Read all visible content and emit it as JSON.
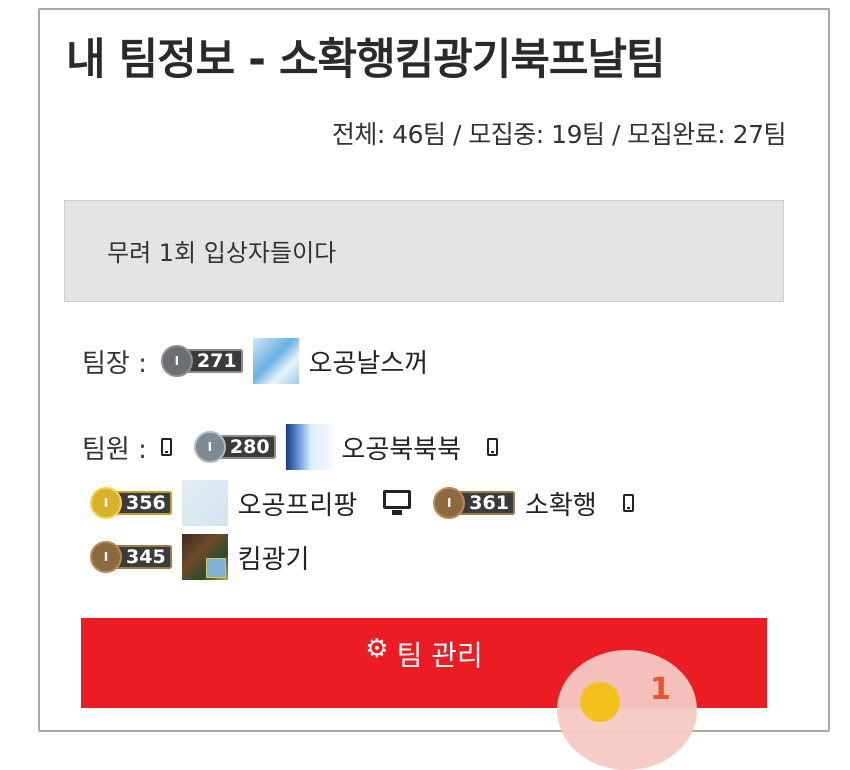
{
  "title": "내 팀정보 - 소확행킴광기북프날팀",
  "stats": "전체: 46팀 / 모집중: 19팀 / 모집완료: 27팀",
  "description": "무려 1회 입상자들이다",
  "leader": {
    "label": "팀장 :",
    "level": "271",
    "name": "오공날스꺼"
  },
  "members_label": "팀원 :",
  "members": [
    {
      "device": "phone-icon",
      "level": "280",
      "name": "오공북북북"
    },
    {
      "device": "phone-icon",
      "level": "356",
      "name": "오공프리팡"
    },
    {
      "device": "monitor-icon",
      "level": "361",
      "name": "소확행"
    },
    {
      "device": "phone-icon",
      "level": "345",
      "name": "킴광기"
    }
  ],
  "manage_button": {
    "label": "팀 관리",
    "icon": "gear-icon"
  },
  "notification_count": "1",
  "colors": {
    "accent": "#ec1c24",
    "box_bg": "#e4e4e4"
  }
}
